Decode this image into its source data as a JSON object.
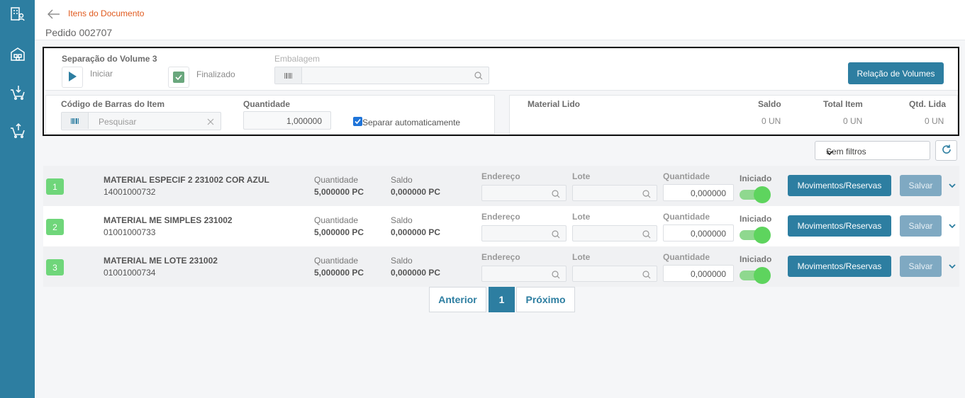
{
  "sidebar": {
    "icons": [
      "building-user-icon",
      "warehouse-icon",
      "cart-down-icon",
      "cart-up-icon"
    ]
  },
  "header": {
    "breadcrumb": "Itens do Documento",
    "subtitle": "Pedido 002707"
  },
  "volume": {
    "title": "Separação do Volume 3",
    "start_label": "Iniciar",
    "finished_label": "Finalizado",
    "packaging_label": "Embalagem",
    "packaging_value": "",
    "relation_button": "Relação de Volumes"
  },
  "scan": {
    "barcode_label": "Código de Barras do Item",
    "barcode_placeholder": "Pesquisar",
    "quantity_label": "Quantidade",
    "quantity_value": "1,000000",
    "auto_separate_label": "Separar automaticamente",
    "auto_separate_checked": true
  },
  "read_summary": {
    "material_label": "Material Lido",
    "columns": [
      {
        "label": "Saldo",
        "value": "0 UN"
      },
      {
        "label": "Total Item",
        "value": "0 UN"
      },
      {
        "label": "Qtd. Lida",
        "value": "0 UN"
      }
    ]
  },
  "filter": {
    "selected": "Sem filtros"
  },
  "items": [
    {
      "index": "1",
      "name": "MATERIAL ESPECIF 2 231002 COR AZUL",
      "code": "14001000732",
      "qty_label": "Quantidade",
      "qty": "5,000000 PC",
      "balance_label": "Saldo",
      "balance": "0,000000 PC",
      "address_label": "Endereço",
      "lot_label": "Lote",
      "quantity_label": "Quantidade",
      "quantity_value": "0,000000",
      "started_label": "Iniciado",
      "started": true,
      "moves_button": "Movimentos/Reservas",
      "save_button": "Salvar"
    },
    {
      "index": "2",
      "name": "MATERIAL ME SIMPLES 231002",
      "code": "01001000733",
      "qty_label": "Quantidade",
      "qty": "5,000000 PC",
      "balance_label": "Saldo",
      "balance": "0,000000 PC",
      "address_label": "Endereço",
      "lot_label": "Lote",
      "quantity_label": "Quantidade",
      "quantity_value": "0,000000",
      "started_label": "Iniciado",
      "started": true,
      "moves_button": "Movimentos/Reservas",
      "save_button": "Salvar"
    },
    {
      "index": "3",
      "name": "MATERIAL ME LOTE 231002",
      "code": "01001000734",
      "qty_label": "Quantidade",
      "qty": "5,000000 PC",
      "balance_label": "Saldo",
      "balance": "0,000000 PC",
      "address_label": "Endereço",
      "lot_label": "Lote",
      "quantity_label": "Quantidade",
      "quantity_value": "0,000000",
      "started_label": "Iniciado",
      "started": true,
      "moves_button": "Movimentos/Reservas",
      "save_button": "Salvar"
    }
  ],
  "pagination": {
    "prev": "Anterior",
    "current": "1",
    "next": "Próximo"
  },
  "colors": {
    "primary": "#2d7ea1",
    "accent": "#e05a1e",
    "badge": "#6fd67a",
    "toggle": "#5ed45e"
  }
}
